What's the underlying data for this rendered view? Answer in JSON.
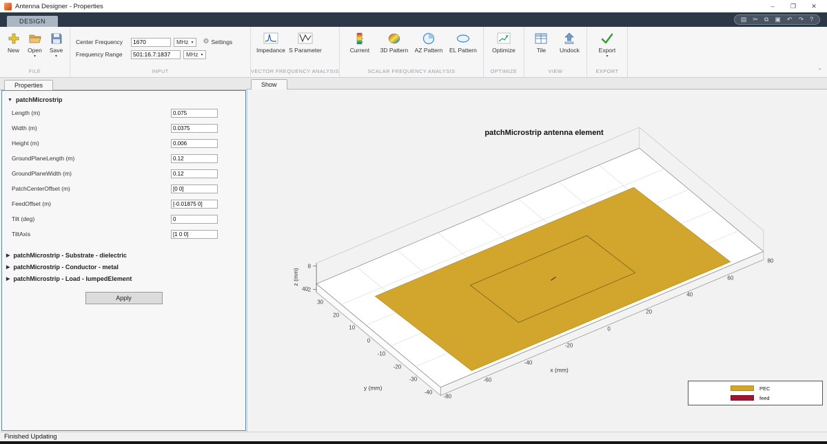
{
  "window": {
    "title": "Antenna Designer - Properties",
    "minimize": "–",
    "maximize": "❐",
    "close": "✕"
  },
  "ribbon": {
    "design_tab": "DESIGN",
    "quick_access": [
      {
        "name": "save",
        "glyph": "▤"
      },
      {
        "name": "cut",
        "glyph": "✂"
      },
      {
        "name": "copy",
        "glyph": "⧉"
      },
      {
        "name": "paste",
        "glyph": "▣"
      },
      {
        "name": "undo",
        "glyph": "↶"
      },
      {
        "name": "redo",
        "glyph": "↷"
      },
      {
        "name": "help",
        "glyph": "?"
      }
    ]
  },
  "toolbar": {
    "file": {
      "label": "FILE",
      "new": "New",
      "open": "Open",
      "save": "Save"
    },
    "input": {
      "label": "INPUT",
      "center_frequency_label": "Center Frequency",
      "center_frequency_value": "1670",
      "center_frequency_unit": "MHz",
      "settings": "Settings",
      "frequency_range_label": "Frequency Range",
      "frequency_range_value": "501:16.7:1837",
      "frequency_range_unit": "MHz"
    },
    "vector": {
      "label": "VECTOR FREQUENCY ANALYSIS",
      "impedance": "Impedance",
      "s_parameter": "S Parameter"
    },
    "scalar": {
      "label": "SCALAR FREQUENCY ANALYSIS",
      "current": "Current",
      "pattern3d": "3D Pattern",
      "az_pattern": "AZ Pattern",
      "el_pattern": "EL Pattern"
    },
    "optimize": {
      "label": "OPTIMIZE",
      "optimize": "Optimize"
    },
    "view": {
      "label": "VIEW",
      "tile": "Tile",
      "undock": "Undock"
    },
    "export": {
      "label": "EXPORT",
      "export": "Export"
    }
  },
  "properties": {
    "tab": "Properties",
    "section": "patchMicrostrip",
    "fields": [
      {
        "label": "Length (m)",
        "value": "0.075"
      },
      {
        "label": "Width (m)",
        "value": "0.0375"
      },
      {
        "label": "Height (m)",
        "value": "0.006"
      },
      {
        "label": "GroundPlaneLength (m)",
        "value": "0.12"
      },
      {
        "label": "GroundPlaneWidth (m)",
        "value": "0.12"
      },
      {
        "label": "PatchCenterOffset (m)",
        "value": "[0 0]"
      },
      {
        "label": "FeedOffset (m)",
        "value": "[-0.01875 0]"
      },
      {
        "label": "Tilt (deg)",
        "value": "0"
      },
      {
        "label": "TiltAxis",
        "value": "[1 0 0]"
      }
    ],
    "collapsed": [
      "patchMicrostrip - Substrate - dielectric",
      "patchMicrostrip - Conductor - metal",
      "patchMicrostrip - Load - lumpedElement"
    ],
    "apply": "Apply"
  },
  "figure": {
    "tab": "Show",
    "title": "patchMicrostrip antenna element",
    "xlabel": "x (mm)",
    "ylabel": "y (mm)",
    "zlabel": "z (mm)",
    "x_ticks": [
      "-80",
      "-60",
      "-40",
      "-20",
      "0",
      "20",
      "40",
      "60",
      "80"
    ],
    "y_ticks": [
      "40",
      "30",
      "20",
      "10",
      "0",
      "-10",
      "-20",
      "-30",
      "-40"
    ],
    "z_ticks": [
      "8",
      "-2"
    ],
    "pec_color": "#d2a62c",
    "feed_color": "#a2142f",
    "legend": [
      {
        "label": "PEC",
        "color": "#d2a62c"
      },
      {
        "label": "feed",
        "color": "#a2142f"
      }
    ]
  },
  "status": "Finished Updating"
}
